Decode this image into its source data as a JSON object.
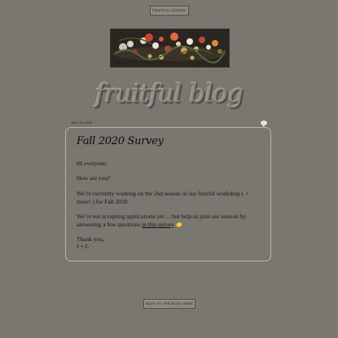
{
  "nav": {
    "school_label": "FRUITFUL SCHOOL"
  },
  "header": {
    "blog_title": "fruitful blog"
  },
  "post": {
    "date": "JULY 14, 2020",
    "title": "Fall 2020 Survey",
    "greeting": "Hi everyone,",
    "question": "How are you?",
    "body_1": "We’re currently working on the 2nd season of our fruitful workshop ( + more! ) for Fall 2020.",
    "body_2_before": "We’re not accepting applications yet ... but help us plan our session by answering a few questions ",
    "survey_link": "in this survey",
    "thanks": "Thank you,",
    "signature": "J + L"
  },
  "footer": {
    "back_label": "BACK TO THE BLOG HOME"
  },
  "icons": {
    "comment": "comment-bubble-icon",
    "lemon": "lemon-icon"
  },
  "colors": {
    "background": "#7a7670",
    "card_border": "#b7b3ac",
    "text": "#141414"
  }
}
